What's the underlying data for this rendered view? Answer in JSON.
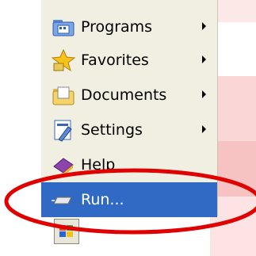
{
  "menu": {
    "items": [
      {
        "label": "Programs",
        "icon": "programs-folder-icon",
        "submenu": true
      },
      {
        "label": "Favorites",
        "icon": "favorites-star-icon",
        "submenu": true
      },
      {
        "label": "Documents",
        "icon": "documents-folder-icon",
        "submenu": true
      },
      {
        "label": "Settings",
        "icon": "settings-icon",
        "submenu": true
      },
      {
        "label": "Help",
        "icon": "help-book-icon",
        "submenu": false
      },
      {
        "label": "Run...",
        "icon": "run-icon",
        "submenu": false,
        "selected": true
      }
    ]
  },
  "colors": {
    "menu_bg": "#f1efe2",
    "selection": "#316ac5",
    "annotation": "#e00000"
  },
  "taskbar": {
    "icon": "windows-start-icon"
  }
}
